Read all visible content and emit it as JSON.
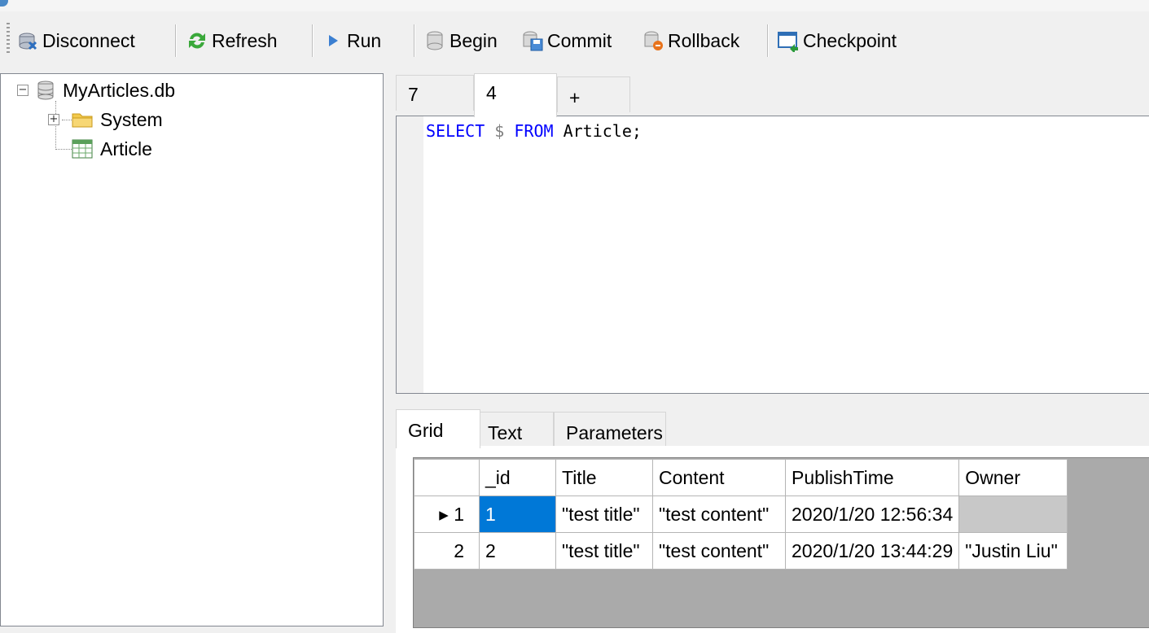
{
  "toolbar": {
    "disconnect_label": "Disconnect",
    "refresh_label": "Refresh",
    "run_label": "Run",
    "begin_label": "Begin",
    "commit_label": "Commit",
    "rollback_label": "Rollback",
    "checkpoint_label": "Checkpoint"
  },
  "tree": {
    "root_label": "MyArticles.db",
    "children": [
      {
        "label": "System",
        "expander": "+"
      },
      {
        "label": "Article"
      }
    ],
    "root_expander": "−"
  },
  "editor": {
    "tabs": [
      "7",
      "4",
      "+"
    ],
    "active_tab": "4",
    "query": {
      "kw1": "SELECT",
      "op": " $ ",
      "kw2": "FROM",
      "rest": " Article;"
    }
  },
  "results": {
    "tabs": [
      "Grid",
      "Text",
      "Parameters"
    ],
    "active_tab": "Grid",
    "columns": [
      "_id",
      "Title",
      "Content",
      "PublishTime",
      "Owner"
    ],
    "rows": [
      {
        "row_label": "▸ 1",
        "cells": [
          "1",
          "\"test title\"",
          "\"test content\"",
          "2020/1/20 12:56:34",
          ""
        ]
      },
      {
        "row_label": "2",
        "cells": [
          "2",
          "\"test title\"",
          "\"test content\"",
          "2020/1/20 13:44:29",
          "\"Justin Liu\""
        ]
      }
    ]
  },
  "colors": {
    "selection": "#0078d7",
    "keyword": "#0000ff",
    "grid_background": "#aaaaaa"
  }
}
